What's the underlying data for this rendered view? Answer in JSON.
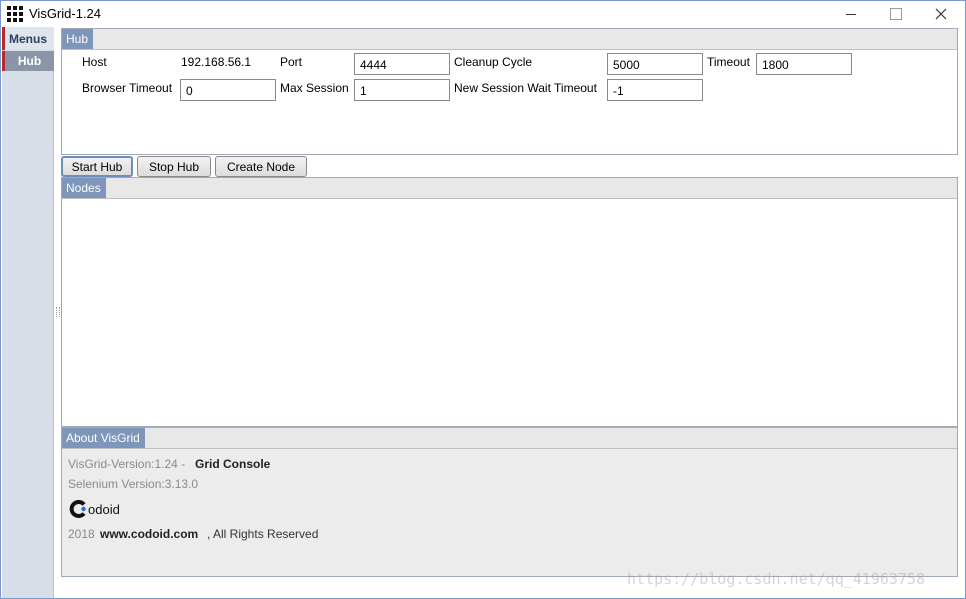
{
  "window": {
    "title": "VisGrid-1.24",
    "accent_color": "#7f96bb"
  },
  "menu": {
    "header": "Menus",
    "items": [
      {
        "label": "Hub",
        "selected": true
      }
    ]
  },
  "hub_panel": {
    "tab": "Hub",
    "host_label": "Host",
    "host_value": "192.168.56.1",
    "port_label": "Port",
    "port_value": "4444",
    "cleanup_label": "Cleanup Cycle",
    "cleanup_value": "5000",
    "timeout_label": "Timeout",
    "timeout_value": "1800",
    "browser_timeout_label": "Browser Timeout",
    "browser_timeout_value": "0",
    "max_session_label": "Max Session",
    "max_session_value": "1",
    "new_session_label": "New Session Wait Timeout",
    "new_session_value": "-1"
  },
  "actions": {
    "start": "Start Hub",
    "stop": "Stop Hub",
    "create": "Create Node"
  },
  "nodes_panel": {
    "tab": "Nodes"
  },
  "about_panel": {
    "tab": "About VisGrid",
    "version_text": "VisGrid-Version:1.24 -",
    "console_text": "Grid Console",
    "selenium_text": "Selenium Version:3.13.0",
    "logo_text": "odoid",
    "year": "2018",
    "website": "www.codoid.com",
    "rights": ", All Rights Reserved"
  },
  "watermark": "https://blog.csdn.net/qq_41963758"
}
